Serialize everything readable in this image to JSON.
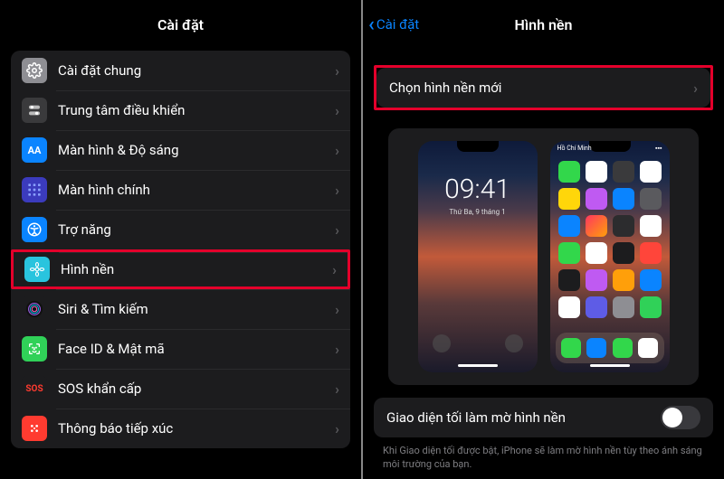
{
  "left": {
    "title": "Cài đặt",
    "items": [
      {
        "label": "Cài đặt chung"
      },
      {
        "label": "Trung tâm điều khiển"
      },
      {
        "label": "Màn hình & Độ sáng"
      },
      {
        "label": "Màn hình chính"
      },
      {
        "label": "Trợ năng"
      },
      {
        "label": "Hình nền"
      },
      {
        "label": "Siri & Tìm kiếm"
      },
      {
        "label": "Face ID & Mật mã"
      },
      {
        "label": "SOS khẩn cấp"
      },
      {
        "label": "Thông báo tiếp xúc"
      }
    ],
    "display_icon_text": "AA",
    "sos_icon_text": "SOS"
  },
  "right": {
    "back_label": "Cài đặt",
    "title": "Hình nền",
    "choose_label": "Chọn hình nền mới",
    "lock_time": "09:41",
    "lock_date": "Thứ Ba, 9 tháng 1",
    "status_carrier": "Hồ Chí Minh",
    "dim_label": "Giao diện tối làm mờ hình nền",
    "dim_toggle_on": false,
    "footnote": "Khi Giao diện tối được bật, iPhone sẽ làm mờ hình nền tùy theo ánh sáng môi trường của bạn."
  }
}
